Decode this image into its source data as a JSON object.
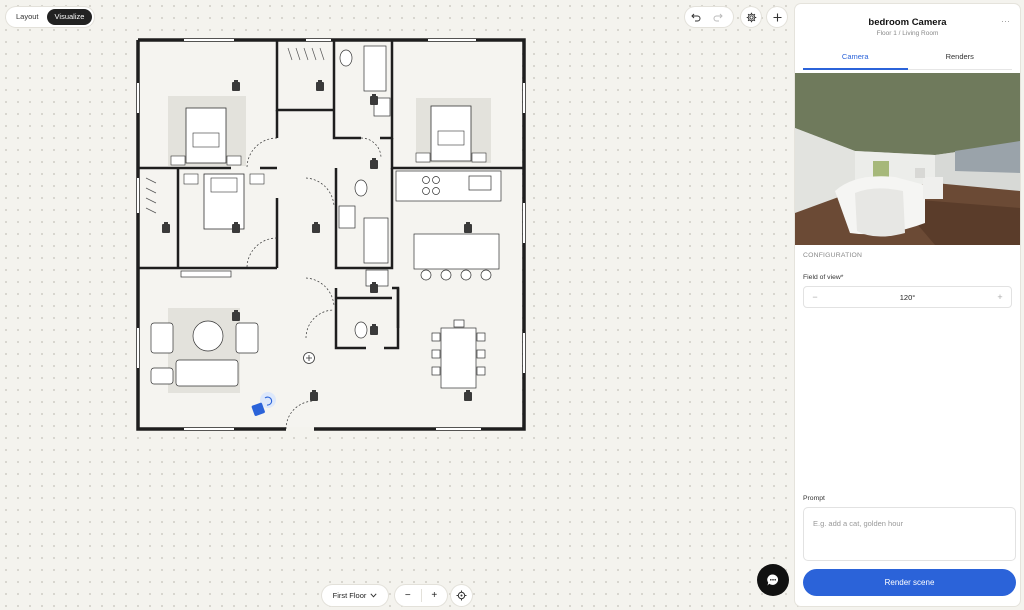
{
  "toolbar": {
    "mode_layout": "Layout",
    "mode_visualize": "Visualize",
    "active_mode": "Visualize",
    "undo_icon": "undo-icon",
    "redo_icon": "redo-icon",
    "settings_icon": "gear-icon",
    "add_icon": "plus-icon"
  },
  "bottom": {
    "floor_selected": "First Floor",
    "zoom_out": "−",
    "zoom_in": "+",
    "recenter_icon": "crosshair-icon"
  },
  "panel": {
    "title": "bedroom Camera",
    "subtitle": "Floor 1 / Living Room",
    "more_icon": "ellipsis-icon",
    "tabs": [
      {
        "label": "Camera",
        "active": true
      },
      {
        "label": "Renders",
        "active": false
      }
    ],
    "section_label": "CONFIGURATION",
    "fov_label": "Field of view*",
    "fov_value": "120°",
    "fov_dec": "−",
    "fov_inc": "+",
    "prompt_label": "Prompt",
    "prompt_placeholder": "E.g. add a cat, golden hour",
    "render_button": "Render scene"
  },
  "colors": {
    "accent": "#2b63d9",
    "wall": "#222222",
    "background": "#f4f3ee"
  }
}
